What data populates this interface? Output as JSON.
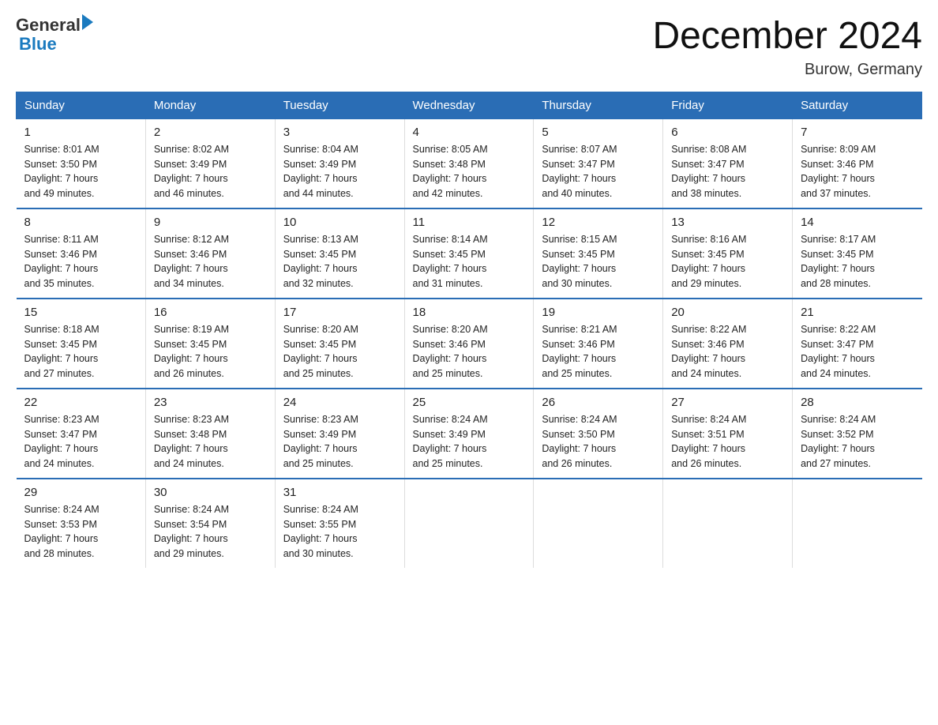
{
  "header": {
    "logo_line1": "General",
    "logo_line2": "Blue",
    "month_title": "December 2024",
    "location": "Burow, Germany"
  },
  "weekdays": [
    "Sunday",
    "Monday",
    "Tuesday",
    "Wednesday",
    "Thursday",
    "Friday",
    "Saturday"
  ],
  "weeks": [
    [
      {
        "day": "1",
        "info": "Sunrise: 8:01 AM\nSunset: 3:50 PM\nDaylight: 7 hours\nand 49 minutes."
      },
      {
        "day": "2",
        "info": "Sunrise: 8:02 AM\nSunset: 3:49 PM\nDaylight: 7 hours\nand 46 minutes."
      },
      {
        "day": "3",
        "info": "Sunrise: 8:04 AM\nSunset: 3:49 PM\nDaylight: 7 hours\nand 44 minutes."
      },
      {
        "day": "4",
        "info": "Sunrise: 8:05 AM\nSunset: 3:48 PM\nDaylight: 7 hours\nand 42 minutes."
      },
      {
        "day": "5",
        "info": "Sunrise: 8:07 AM\nSunset: 3:47 PM\nDaylight: 7 hours\nand 40 minutes."
      },
      {
        "day": "6",
        "info": "Sunrise: 8:08 AM\nSunset: 3:47 PM\nDaylight: 7 hours\nand 38 minutes."
      },
      {
        "day": "7",
        "info": "Sunrise: 8:09 AM\nSunset: 3:46 PM\nDaylight: 7 hours\nand 37 minutes."
      }
    ],
    [
      {
        "day": "8",
        "info": "Sunrise: 8:11 AM\nSunset: 3:46 PM\nDaylight: 7 hours\nand 35 minutes."
      },
      {
        "day": "9",
        "info": "Sunrise: 8:12 AM\nSunset: 3:46 PM\nDaylight: 7 hours\nand 34 minutes."
      },
      {
        "day": "10",
        "info": "Sunrise: 8:13 AM\nSunset: 3:45 PM\nDaylight: 7 hours\nand 32 minutes."
      },
      {
        "day": "11",
        "info": "Sunrise: 8:14 AM\nSunset: 3:45 PM\nDaylight: 7 hours\nand 31 minutes."
      },
      {
        "day": "12",
        "info": "Sunrise: 8:15 AM\nSunset: 3:45 PM\nDaylight: 7 hours\nand 30 minutes."
      },
      {
        "day": "13",
        "info": "Sunrise: 8:16 AM\nSunset: 3:45 PM\nDaylight: 7 hours\nand 29 minutes."
      },
      {
        "day": "14",
        "info": "Sunrise: 8:17 AM\nSunset: 3:45 PM\nDaylight: 7 hours\nand 28 minutes."
      }
    ],
    [
      {
        "day": "15",
        "info": "Sunrise: 8:18 AM\nSunset: 3:45 PM\nDaylight: 7 hours\nand 27 minutes."
      },
      {
        "day": "16",
        "info": "Sunrise: 8:19 AM\nSunset: 3:45 PM\nDaylight: 7 hours\nand 26 minutes."
      },
      {
        "day": "17",
        "info": "Sunrise: 8:20 AM\nSunset: 3:45 PM\nDaylight: 7 hours\nand 25 minutes."
      },
      {
        "day": "18",
        "info": "Sunrise: 8:20 AM\nSunset: 3:46 PM\nDaylight: 7 hours\nand 25 minutes."
      },
      {
        "day": "19",
        "info": "Sunrise: 8:21 AM\nSunset: 3:46 PM\nDaylight: 7 hours\nand 25 minutes."
      },
      {
        "day": "20",
        "info": "Sunrise: 8:22 AM\nSunset: 3:46 PM\nDaylight: 7 hours\nand 24 minutes."
      },
      {
        "day": "21",
        "info": "Sunrise: 8:22 AM\nSunset: 3:47 PM\nDaylight: 7 hours\nand 24 minutes."
      }
    ],
    [
      {
        "day": "22",
        "info": "Sunrise: 8:23 AM\nSunset: 3:47 PM\nDaylight: 7 hours\nand 24 minutes."
      },
      {
        "day": "23",
        "info": "Sunrise: 8:23 AM\nSunset: 3:48 PM\nDaylight: 7 hours\nand 24 minutes."
      },
      {
        "day": "24",
        "info": "Sunrise: 8:23 AM\nSunset: 3:49 PM\nDaylight: 7 hours\nand 25 minutes."
      },
      {
        "day": "25",
        "info": "Sunrise: 8:24 AM\nSunset: 3:49 PM\nDaylight: 7 hours\nand 25 minutes."
      },
      {
        "day": "26",
        "info": "Sunrise: 8:24 AM\nSunset: 3:50 PM\nDaylight: 7 hours\nand 26 minutes."
      },
      {
        "day": "27",
        "info": "Sunrise: 8:24 AM\nSunset: 3:51 PM\nDaylight: 7 hours\nand 26 minutes."
      },
      {
        "day": "28",
        "info": "Sunrise: 8:24 AM\nSunset: 3:52 PM\nDaylight: 7 hours\nand 27 minutes."
      }
    ],
    [
      {
        "day": "29",
        "info": "Sunrise: 8:24 AM\nSunset: 3:53 PM\nDaylight: 7 hours\nand 28 minutes."
      },
      {
        "day": "30",
        "info": "Sunrise: 8:24 AM\nSunset: 3:54 PM\nDaylight: 7 hours\nand 29 minutes."
      },
      {
        "day": "31",
        "info": "Sunrise: 8:24 AM\nSunset: 3:55 PM\nDaylight: 7 hours\nand 30 minutes."
      },
      {
        "day": "",
        "info": ""
      },
      {
        "day": "",
        "info": ""
      },
      {
        "day": "",
        "info": ""
      },
      {
        "day": "",
        "info": ""
      }
    ]
  ]
}
